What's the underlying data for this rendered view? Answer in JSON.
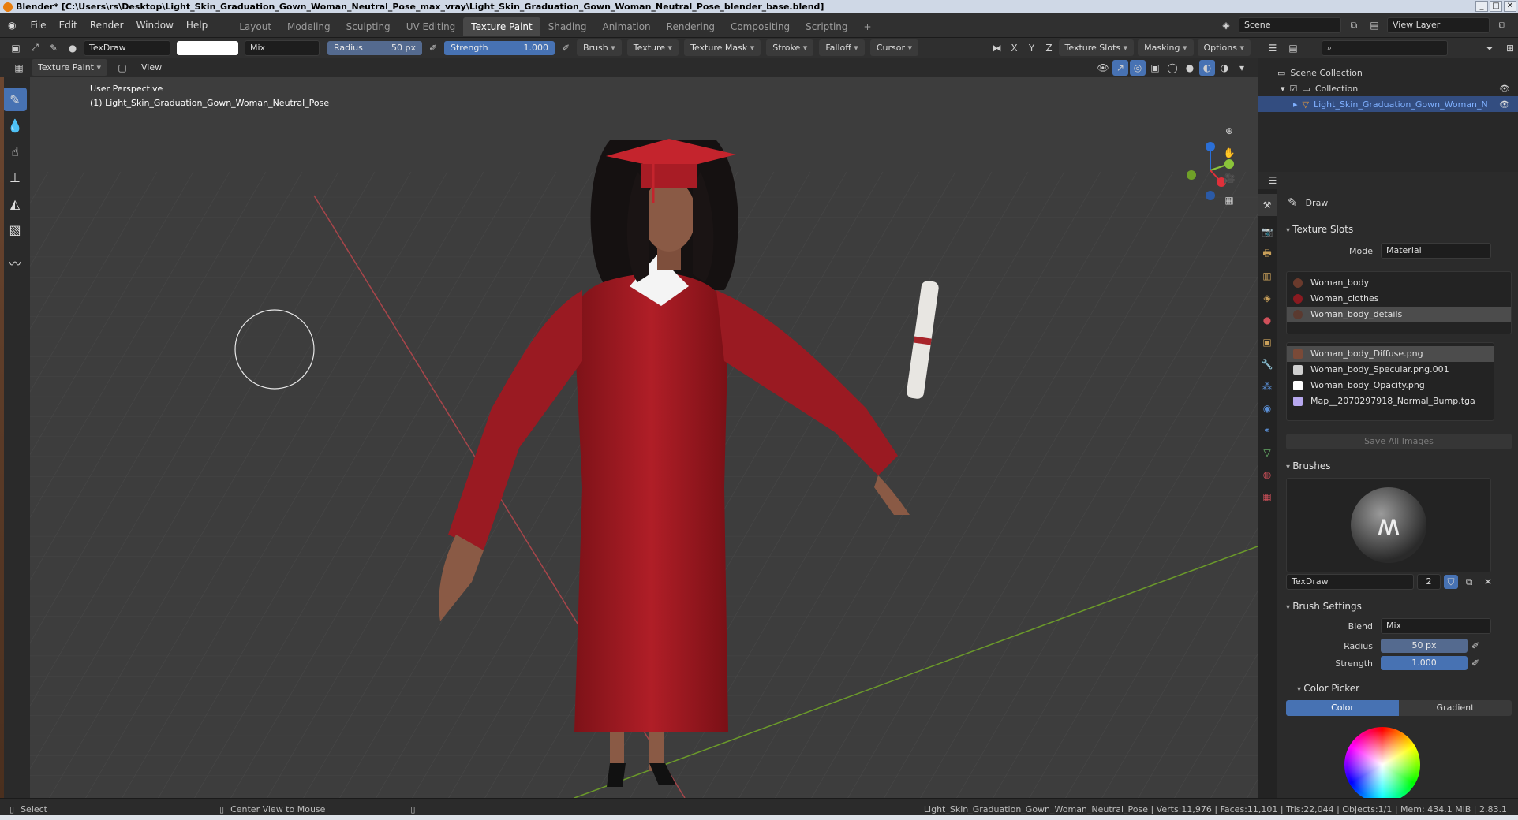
{
  "window": {
    "title": "Blender* [C:\\Users\\rs\\Desktop\\Light_Skin_Graduation_Gown_Woman_Neutral_Pose_max_vray\\Light_Skin_Graduation_Gown_Woman_Neutral_Pose_blender_base.blend]"
  },
  "menu": {
    "items": [
      "File",
      "Edit",
      "Render",
      "Window",
      "Help"
    ]
  },
  "workspaces": {
    "tabs": [
      "Layout",
      "Modeling",
      "Sculpting",
      "UV Editing",
      "Texture Paint",
      "Shading",
      "Animation",
      "Rendering",
      "Compositing",
      "Scripting"
    ],
    "active": "Texture Paint",
    "add_label": "+"
  },
  "scene": {
    "name": "Scene",
    "view_layer": "View Layer"
  },
  "toolheader": {
    "brush_name": "TexDraw",
    "blend": "Mix",
    "radius_label": "Radius",
    "radius_value": "50 px",
    "strength_label": "Strength",
    "strength_value": "1.000",
    "dropdowns": [
      "Brush",
      "Texture",
      "Texture Mask",
      "Stroke",
      "Falloff",
      "Cursor"
    ],
    "axes": [
      "X",
      "Y",
      "Z"
    ],
    "right_dropdowns": [
      "Texture Slots",
      "Masking",
      "Options"
    ]
  },
  "viewheader": {
    "mode": "Texture Paint",
    "view": "View"
  },
  "viewport": {
    "perspective": "User Perspective",
    "object_info": "(1) Light_Skin_Graduation_Gown_Woman_Neutral_Pose",
    "gizmo": {
      "x": "X",
      "y": "Y",
      "z": "Z"
    }
  },
  "outliner": {
    "root": "Scene Collection",
    "collection": "Collection",
    "object": "Light_Skin_Graduation_Gown_Woman_Neutral_Pose"
  },
  "properties": {
    "tool_name": "Draw",
    "texture_slots_title": "Texture Slots",
    "mode_label": "Mode",
    "mode_value": "Material",
    "materials": [
      "Woman_body",
      "Woman_clothes",
      "Woman_body_details"
    ],
    "images": [
      "Woman_body_Diffuse.png",
      "Woman_body_Specular.png.001",
      "Woman_body_Opacity.png",
      "Map__2070297918_Normal_Bump.tga"
    ],
    "save_all": "Save All Images",
    "brushes_title": "Brushes",
    "brush_name": "TexDraw",
    "brush_users": "2",
    "brush_settings_title": "Brush Settings",
    "blend_label": "Blend",
    "blend_value": "Mix",
    "radius_label": "Radius",
    "radius_value": "50 px",
    "strength_label": "Strength",
    "strength_value": "1.000",
    "color_picker_title": "Color Picker",
    "color_tab": "Color",
    "gradient_tab": "Gradient"
  },
  "statusbar": {
    "select": "Select",
    "center": "Center View to Mouse",
    "stats": "Light_Skin_Graduation_Gown_Woman_Neutral_Pose | Verts:11,976 | Faces:11,101 | Tris:22,044 | Objects:1/1 | Mem: 434.1 MiB | 2.83.1"
  },
  "colors": {
    "accent": "#4772b3",
    "gown": "#a01a22",
    "grid_red": "#a8454a",
    "grid_green": "#6b9a2a"
  }
}
